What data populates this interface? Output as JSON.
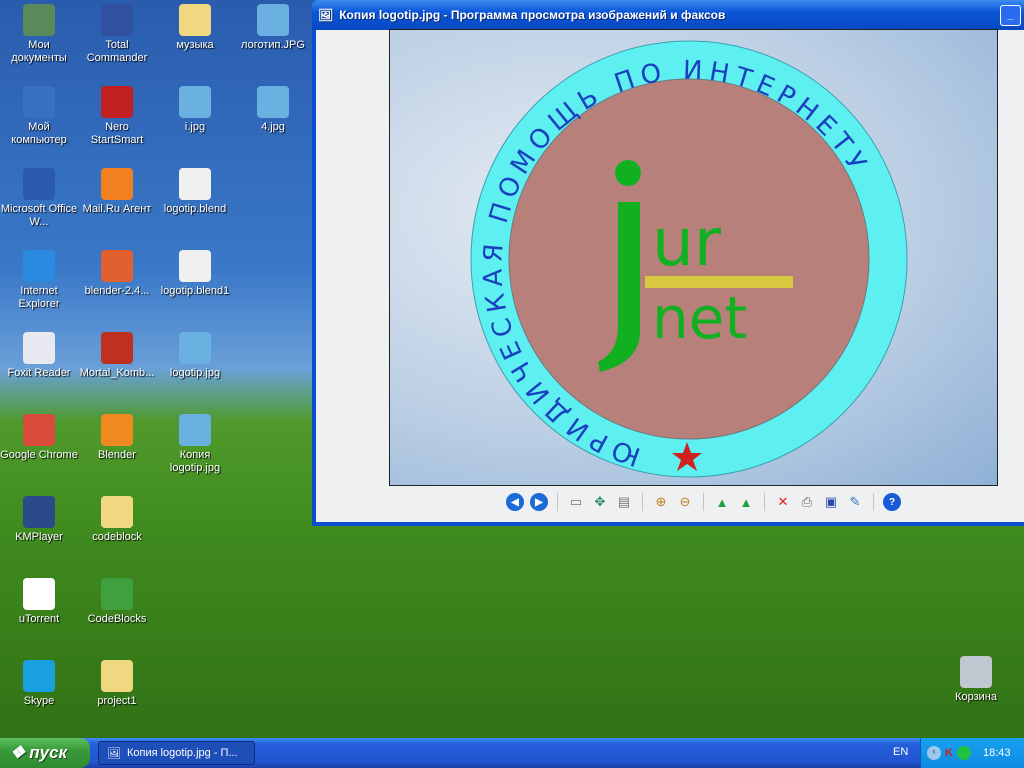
{
  "desktop_icons": [
    {
      "label": "Мои документы",
      "icon": "my-documents-icon",
      "color": "#5a8a5a"
    },
    {
      "label": "Мой компьютер",
      "icon": "my-computer-icon",
      "color": "#3a70c0"
    },
    {
      "label": "Microsoft Office W...",
      "icon": "word-icon",
      "color": "#2a5bb0"
    },
    {
      "label": "Internet Explorer",
      "icon": "ie-icon",
      "color": "#2a8ae0"
    },
    {
      "label": "Foxit Reader",
      "icon": "foxit-icon",
      "color": "#e8e8f0"
    },
    {
      "label": "Google Chrome",
      "icon": "chrome-icon",
      "color": "#d84a3a"
    },
    {
      "label": "KMPlayer",
      "icon": "kmplayer-icon",
      "color": "#2a4a8a"
    },
    {
      "label": "uTorrent",
      "icon": "utorrent-icon",
      "color": "#ffffff"
    },
    {
      "label": "Skype",
      "icon": "skype-icon",
      "color": "#1aa0e0"
    },
    {
      "label": "Total Commander",
      "icon": "total-commander-icon",
      "color": "#3050a0"
    },
    {
      "label": "Nero StartSmart",
      "icon": "nero-icon",
      "color": "#c02020"
    },
    {
      "label": "Mail.Ru Агент",
      "icon": "mailru-agent-icon",
      "color": "#f08020"
    },
    {
      "label": "blender-2.4...",
      "icon": "installer-icon",
      "color": "#e06030"
    },
    {
      "label": "Mortal_Komb...",
      "icon": "mortal-kombat-icon",
      "color": "#c03020"
    },
    {
      "label": "Blender",
      "icon": "blender-icon",
      "color": "#f08a20"
    },
    {
      "label": "codeblock",
      "icon": "folder-icon",
      "color": "#f0d880"
    },
    {
      "label": "CodeBlocks",
      "icon": "codeblocks-icon",
      "color": "#40a040"
    },
    {
      "label": "project1",
      "icon": "folder-icon",
      "color": "#f0d880"
    },
    {
      "label": "музыка",
      "icon": "folder-icon",
      "color": "#f0d880"
    },
    {
      "label": "i.jpg",
      "icon": "image-file-icon",
      "color": "#6ab0e0"
    },
    {
      "label": "logotip.blend",
      "icon": "blend-file-icon",
      "color": "#f0f0f0"
    },
    {
      "label": "logotip.blend1",
      "icon": "file-icon",
      "color": "#f0f0f0"
    },
    {
      "label": "logotip.jpg",
      "icon": "image-file-icon",
      "color": "#6ab0e0"
    },
    {
      "label": "Копия logotip.jpg",
      "icon": "image-file-icon",
      "color": "#6ab0e0"
    },
    {
      "label": "логотип.JPG",
      "icon": "image-file-icon",
      "color": "#6ab0e0"
    },
    {
      "label": "4.jpg",
      "icon": "image-file-icon",
      "color": "#6ab0e0"
    },
    {
      "label": "Корзина",
      "icon": "recycle-bin-icon",
      "color": "#c0c8d0"
    }
  ],
  "viewer": {
    "title": "Копия logotip.jpg - Программа просмотра изображений и факсов",
    "image": {
      "ring_text": "ЮРИДИЧЕСКАЯ ПОМОЩЬ ПО ИНТЕРНЕТУ",
      "logo_top": "ur",
      "logo_bottom": "net",
      "ring_color": "#5ef0f0",
      "disc_color": "#b8807a",
      "logo_color": "#10b020",
      "bar_color": "#d8c840"
    },
    "toolbar": [
      {
        "name": "previous-image",
        "icon": "◀",
        "color": "#1a6ad8"
      },
      {
        "name": "next-image",
        "icon": "▶",
        "color": "#1a6ad8"
      },
      {
        "sep": true
      },
      {
        "name": "best-fit",
        "icon": "▭",
        "color": "#777"
      },
      {
        "name": "actual-size",
        "icon": "✥",
        "color": "#2a8a6a"
      },
      {
        "name": "slideshow",
        "icon": "▤",
        "color": "#777"
      },
      {
        "sep": true
      },
      {
        "name": "zoom-in",
        "icon": "⊕",
        "color": "#c08020"
      },
      {
        "name": "zoom-out",
        "icon": "⊖",
        "color": "#c08020"
      },
      {
        "sep": true
      },
      {
        "name": "rotate-clockwise",
        "icon": "▲",
        "color": "#20a040"
      },
      {
        "name": "rotate-counterclockwise",
        "icon": "▲",
        "color": "#20a040"
      },
      {
        "sep": true
      },
      {
        "name": "delete",
        "icon": "✕",
        "color": "#e02020"
      },
      {
        "name": "print",
        "icon": "⎙",
        "color": "#666"
      },
      {
        "name": "save",
        "icon": "▣",
        "color": "#2a4ab0"
      },
      {
        "name": "edit",
        "icon": "✎",
        "color": "#3a7ac0"
      },
      {
        "sep": true
      },
      {
        "name": "help",
        "icon": "?",
        "color": "#1a5ad8"
      }
    ]
  },
  "taskbar": {
    "start": "пуск",
    "task": "Копия logotip.jpg - П...",
    "lang": "EN",
    "clock": "18:43"
  }
}
